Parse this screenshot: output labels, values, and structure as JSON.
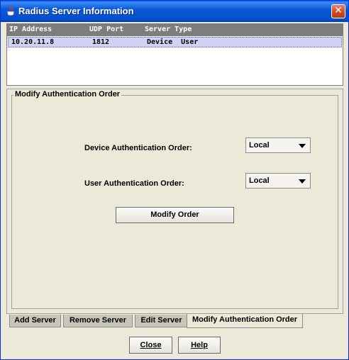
{
  "window": {
    "title": "Radius Server Information",
    "close_glyph": "✕"
  },
  "table": {
    "columns": [
      "IP Address",
      "UDP Port",
      "Server Type"
    ],
    "rows": [
      {
        "ip": "10.20.11.8",
        "port": "1812",
        "type": "Device  User"
      }
    ]
  },
  "group": {
    "title": "Modify Authentication Order",
    "device_label": "Device Authentication Order:",
    "device_value": "Local",
    "user_label": "User Authentication Order:",
    "user_value": "Local",
    "modify_button": "Modify Order"
  },
  "tabs": [
    "Add Server",
    "Remove Server",
    "Edit Server",
    "Modify Authentication Order"
  ],
  "active_tab": "Modify Authentication Order",
  "buttons": {
    "close": "Close",
    "help": "Help"
  },
  "colors": {
    "title_bar": "#0a58d6",
    "header_bg": "#7d7d7d",
    "row_selected": "#d2d2f2"
  }
}
